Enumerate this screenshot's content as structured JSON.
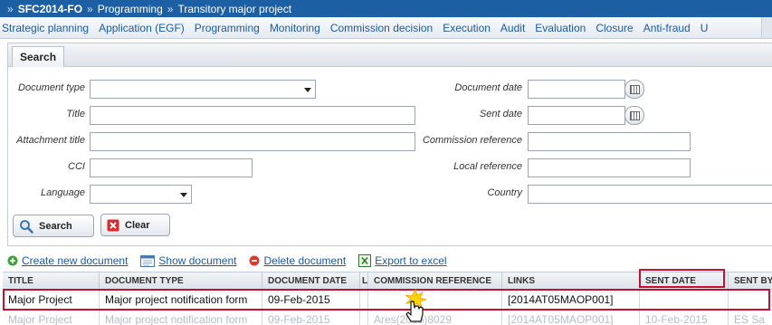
{
  "breadcrumb": [
    {
      "label": "SFC2014-FO",
      "bold": true
    },
    {
      "label": "Programming",
      "bold": false
    },
    {
      "label": "Transitory major project",
      "bold": false
    }
  ],
  "breadcrumb_separator": "»",
  "menu": {
    "items": [
      "Strategic planning",
      "Application (EGF)",
      "Programming",
      "Monitoring",
      "Commission decision",
      "Execution",
      "Audit",
      "Evaluation",
      "Closure",
      "Anti-fraud",
      "U"
    ]
  },
  "search_panel": {
    "tab_label": "Search",
    "fields": {
      "document_type": {
        "label": "Document type",
        "value": ""
      },
      "title": {
        "label": "Title",
        "value": ""
      },
      "attachment_title": {
        "label": "Attachment title",
        "value": ""
      },
      "cci": {
        "label": "CCI",
        "value": ""
      },
      "language": {
        "label": "Language",
        "value": ""
      },
      "document_date": {
        "label": "Document date",
        "value": ""
      },
      "sent_date": {
        "label": "Sent date",
        "value": ""
      },
      "commission_reference": {
        "label": "Commission reference",
        "value": ""
      },
      "local_reference": {
        "label": "Local reference",
        "value": ""
      },
      "country": {
        "label": "Country",
        "value": ""
      }
    },
    "search_button": "Search",
    "clear_button": "Clear"
  },
  "toolbar": {
    "create": "Create new document",
    "show": "Show document",
    "delete": "Delete document",
    "export": "Export to excel"
  },
  "grid": {
    "columns": [
      "TITLE",
      "DOCUMENT TYPE",
      "DOCUMENT DATE",
      "L",
      "COMMISSION REFERENCE",
      "LINKS",
      "SENT DATE",
      "SENT BY"
    ],
    "rows": [
      {
        "title": "Major Project",
        "document_type": "Major project notification form",
        "document_date": "09-Feb-2015",
        "l": "",
        "commission_reference": "",
        "links": "[2014AT05MAOP001]",
        "sent_date": "",
        "sent_by": ""
      },
      {
        "title": "Major Project",
        "document_type": "Major project notification form",
        "document_date": "09-Feb-2015",
        "l": "",
        "commission_reference": "Ares(2015)8029",
        "links": "[2014AT05MAOP001]",
        "sent_date": "10-Feb-2015",
        "sent_by": "ES Sa"
      }
    ]
  },
  "colors": {
    "breadcrumb_bg": "#1d5fa3",
    "menu_link": "#1a5aa5",
    "highlight": "#c8102e"
  }
}
